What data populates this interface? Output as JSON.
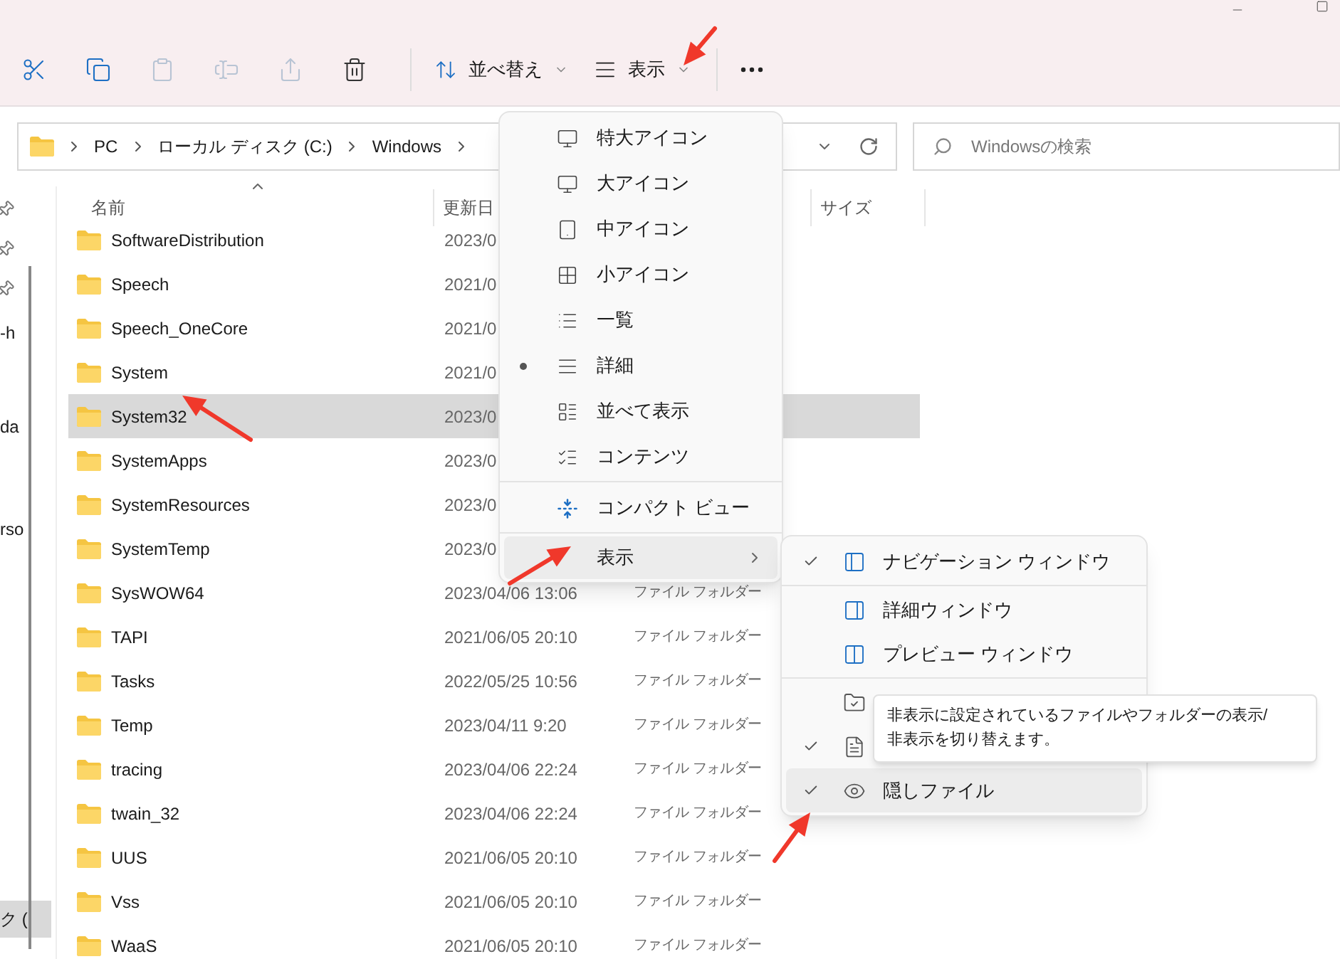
{
  "toolbar": {
    "actions": [
      {
        "disabled": false
      },
      {
        "disabled": false
      },
      {
        "disabled": true
      },
      {
        "disabled": true
      },
      {
        "disabled": true
      },
      {
        "disabled": false
      }
    ],
    "sort_label": "並べ替え",
    "view_label": "表示"
  },
  "address": {
    "path": [
      "PC",
      "ローカル ディスク (C:)",
      "Windows"
    ]
  },
  "search": {
    "placeholder": "Windowsの検索"
  },
  "nav": {
    "items": [
      {
        "label": "-h",
        "selected": false
      },
      {
        "label": "da",
        "selected": false
      },
      {
        "label": "rso",
        "selected": false
      },
      {
        "label": "ク (",
        "selected": true
      }
    ]
  },
  "columns": [
    "名前",
    "更新日",
    "サイズ"
  ],
  "rows": [
    {
      "name": "SoftwareDistribution",
      "date": "2023/0",
      "selected": false
    },
    {
      "name": "Speech",
      "date": "2021/0",
      "selected": false
    },
    {
      "name": "Speech_OneCore",
      "date": "2021/0",
      "selected": false
    },
    {
      "name": "System",
      "date": "2021/0",
      "selected": false
    },
    {
      "name": "System32",
      "date": "2023/0",
      "selected": true
    },
    {
      "name": "SystemApps",
      "date": "2023/0",
      "selected": false
    },
    {
      "name": "SystemResources",
      "date": "2023/0",
      "selected": false
    },
    {
      "name": "SystemTemp",
      "date": "2023/0",
      "selected": false
    },
    {
      "name": "SysWOW64",
      "date": "2023/04/06 13:06",
      "type": "ファイル フォルダー",
      "selected": false
    },
    {
      "name": "TAPI",
      "date": "2021/06/05 20:10",
      "type": "ファイル フォルダー",
      "selected": false
    },
    {
      "name": "Tasks",
      "date": "2022/05/25 10:56",
      "type": "ファイル フォルダー",
      "selected": false
    },
    {
      "name": "Temp",
      "date": "2023/04/11 9:20",
      "type": "ファイル フォルダー",
      "selected": false
    },
    {
      "name": "tracing",
      "date": "2023/04/06 22:24",
      "type": "ファイル フォルダー",
      "selected": false
    },
    {
      "name": "twain_32",
      "date": "2023/04/06 22:24",
      "type": "ファイル フォルダー",
      "selected": false
    },
    {
      "name": "UUS",
      "date": "2021/06/05 20:10",
      "type": "ファイル フォルダー",
      "selected": false
    },
    {
      "name": "Vss",
      "date": "2021/06/05 20:10",
      "type": "ファイル フォルダー",
      "selected": false
    },
    {
      "name": "WaaS",
      "date": "2021/06/05 20:10",
      "type": "ファイル フォルダー",
      "selected": false
    }
  ],
  "view_menu": {
    "layouts": [
      {
        "label": "特大アイコン",
        "selected": false
      },
      {
        "label": "大アイコン",
        "selected": false
      },
      {
        "label": "中アイコン",
        "selected": false
      },
      {
        "label": "小アイコン",
        "selected": false
      },
      {
        "label": "一覧",
        "selected": false
      },
      {
        "label": "詳細",
        "selected": true
      },
      {
        "label": "並べて表示",
        "selected": false
      },
      {
        "label": "コンテンツ",
        "selected": false
      }
    ],
    "compact": {
      "label": "コンパクト ビュー"
    },
    "show": {
      "label": "表示",
      "highlighted": true
    }
  },
  "show_menu": {
    "items": [
      {
        "label": "ナビゲーション ウィンドウ",
        "checked": true,
        "highlighted": false
      },
      {
        "label": "詳細ウィンドウ",
        "checked": false,
        "highlighted": false
      },
      {
        "label": "プレビュー ウィンドウ",
        "checked": false,
        "highlighted": false
      },
      {
        "checked": false,
        "highlighted": false
      },
      {
        "checked": true,
        "highlighted": false
      },
      {
        "label": "隠しファイル",
        "checked": true,
        "highlighted": true
      }
    ]
  },
  "tooltip": {
    "lines": [
      "非表示に設定されているファイルやフォルダーの表示/",
      "非表示を切り替えます。"
    ]
  }
}
